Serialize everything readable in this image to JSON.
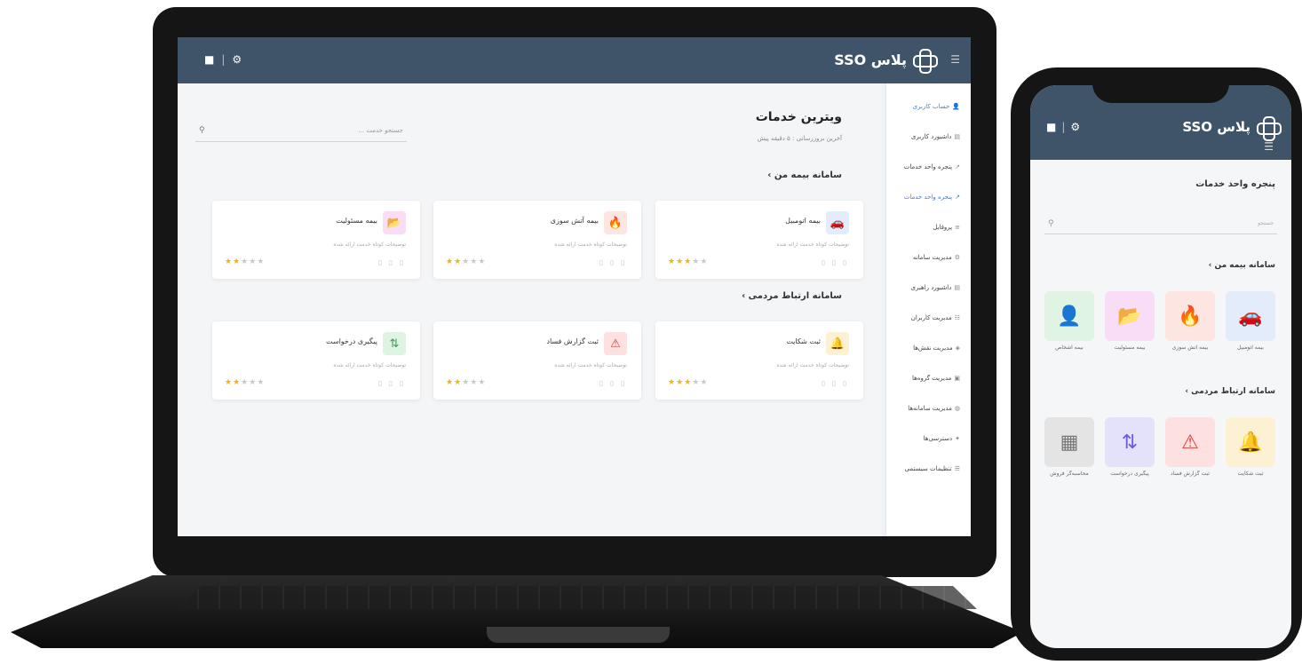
{
  "app": {
    "brand": "SSO پلاس"
  },
  "laptop": {
    "header": {
      "user_icon": "user-icon",
      "settings_icon": "gear-icon",
      "menu_icon": "menu-icon"
    },
    "sidebar": {
      "items": [
        {
          "label": "حساب کاربری",
          "icon": "user-icon",
          "active": true
        },
        {
          "label": "داشبورد کاربری",
          "icon": "chart-icon",
          "active": false
        },
        {
          "label": "پنجره واحد خدمات",
          "icon": "external-link-icon",
          "active": false
        },
        {
          "label": "پنجره واحد خدمات",
          "icon": "external-link-icon",
          "active": true
        },
        {
          "label": "پروفایل",
          "icon": "list-icon",
          "active": false
        },
        {
          "label": "مدیریت سامانه",
          "icon": "settings-icon",
          "active": false
        },
        {
          "label": "داشبورد راهبری",
          "icon": "chart-icon",
          "active": false
        },
        {
          "label": "مدیریت کاربران",
          "icon": "users-icon",
          "active": false
        },
        {
          "label": "مدیریت نقش‌ها",
          "icon": "roles-icon",
          "active": false
        },
        {
          "label": "مدیریت گروه‌ها",
          "icon": "groups-icon",
          "active": false
        },
        {
          "label": "مدیریت سامانه‌ها",
          "icon": "globe-icon",
          "active": false
        },
        {
          "label": "دسترسی‌ها",
          "icon": "key-icon",
          "active": false
        },
        {
          "label": "تنظیمات سیستمی",
          "icon": "sliders-icon",
          "active": false
        }
      ]
    },
    "main": {
      "title": "ویترین خدمات",
      "subtitle": "آخرین بروزرسانی : ۵ دقیقه پیش",
      "search_placeholder": "جستجو خدمت ...",
      "sections": [
        {
          "title": "سامانه بیمه من",
          "cards": [
            {
              "name": "بیمه اتومبیل",
              "desc": "توضیحات کوتاه خدمت ارائه شده",
              "icon": "car-icon",
              "color": "#e3ecfa",
              "fg": "#3b73c7",
              "stars": 3
            },
            {
              "name": "بیمه آتش سوزی",
              "desc": "توضیحات کوتاه خدمت ارائه شده",
              "icon": "fire-icon",
              "color": "#fde6e1",
              "fg": "#e8532e",
              "stars": 2
            },
            {
              "name": "بیمه مسئولیت",
              "desc": "توضیحات کوتاه خدمت ارائه شده",
              "icon": "folder-icon",
              "color": "#f9dcf5",
              "fg": "#c83ec0",
              "stars": 2
            }
          ]
        },
        {
          "title": "سامانه ارتباط مردمی",
          "cards": [
            {
              "name": "ثبت شکایت",
              "desc": "توضیحات کوتاه خدمت ارائه شده",
              "icon": "bell-icon",
              "color": "#fdf1d4",
              "fg": "#f2a516",
              "stars": 3
            },
            {
              "name": "ثبت گزارش فساد",
              "desc": "توضیحات کوتاه خدمت ارائه شده",
              "icon": "warning-icon",
              "color": "#fde0e0",
              "fg": "#e23d3d",
              "stars": 2
            },
            {
              "name": "پیگیری درخواست",
              "desc": "توضیحات کوتاه خدمت ارائه شده",
              "icon": "pull-request-icon",
              "color": "#dff4e2",
              "fg": "#3c9b4f",
              "stars": 2
            }
          ]
        }
      ]
    }
  },
  "phone": {
    "title": "پنجره واحد خدمات",
    "search_placeholder": "جستجو",
    "sections": [
      {
        "title": "سامانه بیمه من",
        "tiles": [
          {
            "label": "بیمه اتومبیل",
            "icon": "car-icon",
            "color": "#e3ecfa",
            "fg": "#3b73c7"
          },
          {
            "label": "بیمه آتش سوزی",
            "icon": "fire-icon",
            "color": "#fde6e1",
            "fg": "#e8532e"
          },
          {
            "label": "بیمه مسئولیت",
            "icon": "folder-icon",
            "color": "#f9dcf5",
            "fg": "#c83ec0"
          },
          {
            "label": "بیمه اشخاص",
            "icon": "person-icon",
            "color": "#dff4e2",
            "fg": "#3c9b4f"
          }
        ]
      },
      {
        "title": "سامانه ارتباط مردمی",
        "tiles": [
          {
            "label": "ثبت شکایت",
            "icon": "bell-icon",
            "color": "#fdf1d4",
            "fg": "#f2a516"
          },
          {
            "label": "ثبت گزارش فساد",
            "icon": "warning-icon",
            "color": "#fde0e0",
            "fg": "#e23d3d"
          },
          {
            "label": "پیگیری درخواست",
            "icon": "pull-request-icon",
            "color": "#e4e2fb",
            "fg": "#6a5dd9"
          },
          {
            "label": "محاسبه‌گر فروش",
            "icon": "calculator-icon",
            "color": "#e4e4e4",
            "fg": "#777777"
          }
        ]
      }
    ]
  }
}
